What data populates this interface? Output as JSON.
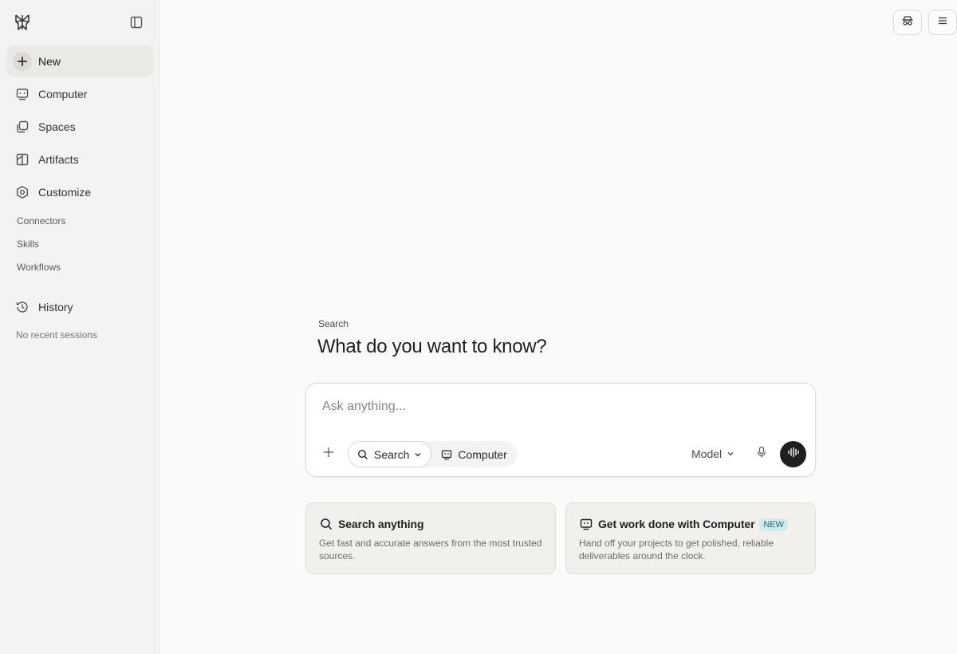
{
  "sidebar": {
    "items": [
      {
        "label": "New",
        "icon": "plus-icon"
      },
      {
        "label": "Computer",
        "icon": "computer-icon"
      },
      {
        "label": "Spaces",
        "icon": "spaces-icon"
      },
      {
        "label": "Artifacts",
        "icon": "artifacts-icon"
      },
      {
        "label": "Customize",
        "icon": "customize-icon"
      }
    ],
    "sub_items": [
      "Connectors",
      "Skills",
      "Workflows"
    ],
    "history_label": "History",
    "no_recent": "No recent sessions"
  },
  "main": {
    "eyebrow": "Search",
    "headline": "What do you want to know?",
    "composer": {
      "placeholder": "Ask anything...",
      "modes": [
        "Search",
        "Computer"
      ],
      "model_label": "Model"
    },
    "cards": [
      {
        "title": "Search anything",
        "description": "Get fast and accurate answers from the most trusted sources.",
        "badge": ""
      },
      {
        "title": "Get work done with Computer",
        "description": "Hand off your projects to get polished, reliable deliverables around the clock.",
        "badge": "NEW"
      }
    ]
  },
  "colors": {
    "sidebar_bg": "#f4f3f1",
    "page_bg": "#fbfaf8",
    "accent_badge_bg": "#d3e9ea",
    "accent_badge_text": "#1f6b72",
    "voice_button": "#1f1f1d"
  }
}
